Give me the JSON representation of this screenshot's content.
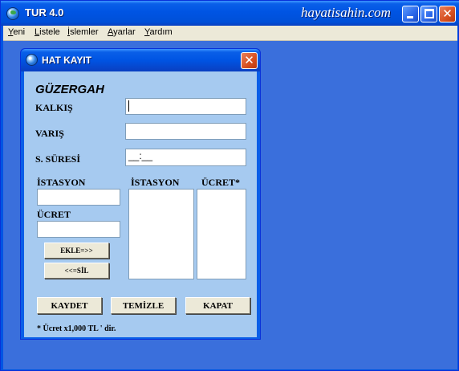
{
  "app": {
    "title": "TUR 4.0",
    "brand": "hayatisahin.com",
    "minimize_icon": "minimize-icon",
    "maximize_icon": "maximize-icon",
    "close_icon": "close-icon"
  },
  "menu": {
    "items": [
      {
        "accel": "Y",
        "rest": "eni"
      },
      {
        "accel": "L",
        "rest": "istele"
      },
      {
        "accel": "İ",
        "rest": "slemler"
      },
      {
        "accel": "A",
        "rest": "yarlar"
      },
      {
        "accel": "Y",
        "rest": "ardım"
      }
    ]
  },
  "dialog": {
    "title": "HAT KAYIT",
    "close_glyph": "✕",
    "section_title": "GÜZERGAH",
    "fields": {
      "departure_label": "KALKIŞ",
      "departure_value": "",
      "arrival_label": "VARIŞ",
      "arrival_value": "",
      "duration_label": "S. SÜRESİ",
      "duration_value": "__:__"
    },
    "station_label": "İSTASYON",
    "station_value": "",
    "fare_label": "ÜCRET",
    "fare_value": "",
    "add_button": "EKLE=>>",
    "delete_button": "<<=SİL",
    "list_station_header": "İSTASYON",
    "list_fare_header": "ÜCRET*",
    "stations_list": [],
    "fares_list": [],
    "save_button": "KAYDET",
    "clear_button": "TEMİZLE",
    "close_button": "KAPAT",
    "footnote": "* Ücret x1,000 TL ' dir."
  },
  "colors": {
    "titlebar": "#0054e3",
    "mdi_background": "#3a6fdc",
    "dialog_body": "#a6caf0",
    "menubar": "#ece9d8",
    "close_button": "#d74f1f"
  }
}
